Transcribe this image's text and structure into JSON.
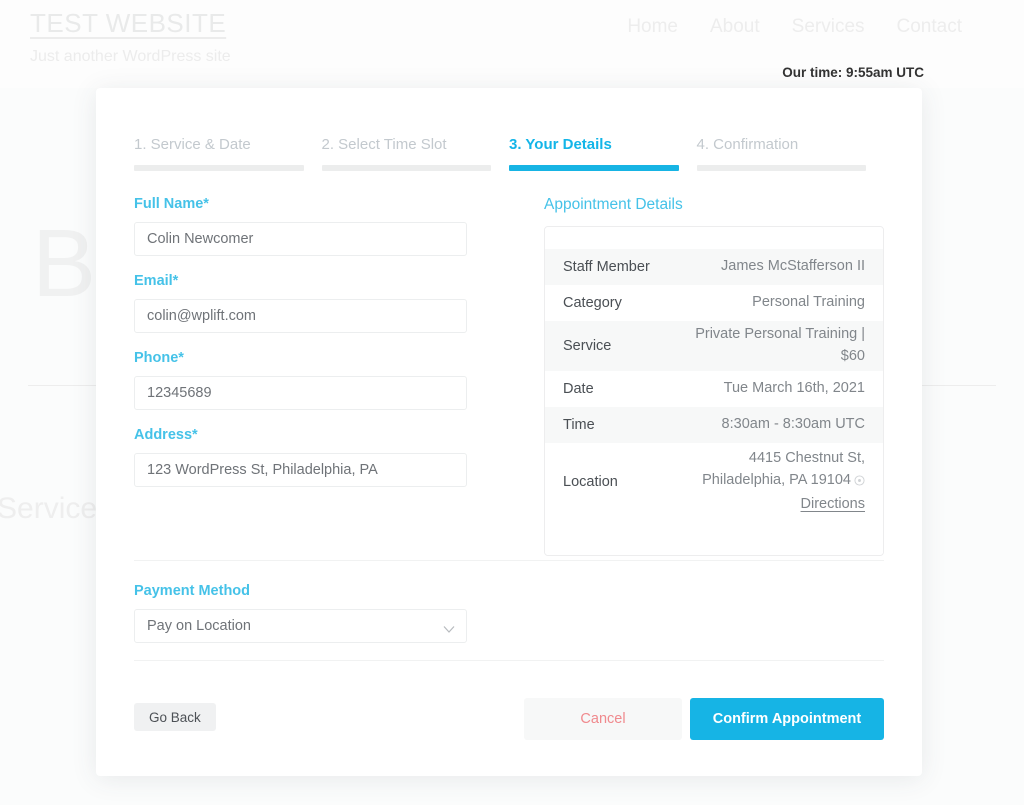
{
  "site": {
    "title": "TEST WEBSITE",
    "tagline": "Just another WordPress site",
    "nav": [
      "Home",
      "About",
      "Services",
      "Contact"
    ],
    "our_time": "Our time: 9:55am UTC",
    "hero_word": "Bo",
    "bg_subword": "ur Service"
  },
  "booking": {
    "steps": [
      {
        "label": "1. Service & Date",
        "active": false
      },
      {
        "label": "2. Select Time Slot",
        "active": false
      },
      {
        "label": "3. Your Details",
        "active": true
      },
      {
        "label": "4. Confirmation",
        "active": false
      }
    ],
    "form": {
      "fields": [
        {
          "label": "Full Name*",
          "value": "Colin Newcomer",
          "placeholder": "Full Name",
          "name": "full-name"
        },
        {
          "label": "Email*",
          "value": "colin@wplift.com",
          "placeholder": "Email",
          "name": "email"
        },
        {
          "label": "Phone*",
          "value": "12345689",
          "placeholder": "Phone",
          "name": "phone"
        },
        {
          "label": "Address*",
          "value": "123 WordPress St, Philadelphia, PA",
          "placeholder": "Address",
          "name": "address"
        }
      ]
    },
    "details": {
      "title": "Appointment Details",
      "rows": [
        {
          "key": "Staff Member",
          "value": "James McStafferson II"
        },
        {
          "key": "Category",
          "value": "Personal Training"
        },
        {
          "key": "Service",
          "value": "Private Personal Training | $60"
        },
        {
          "key": "Date",
          "value": "Tue March 16th, 2021"
        },
        {
          "key": "Time",
          "value": "8:30am - 8:30am UTC"
        }
      ],
      "location": {
        "key": "Location",
        "line1": "4415 Chestnut St,",
        "line2": "Philadelphia, PA 19104",
        "directions": "Directions",
        "pin_icon": "map-pin-icon"
      }
    },
    "payment": {
      "label": "Payment Method",
      "selected": "Pay on Location",
      "options": [
        "Pay on Location"
      ],
      "chevron_icon": "chevron-down-icon"
    },
    "buttons": {
      "go_back": "Go Back",
      "cancel": "Cancel",
      "confirm": "Confirm Appointment"
    }
  },
  "colors": {
    "accent": "#16b4e5",
    "label": "#45c2e8",
    "cancel_text": "#f08a8e",
    "step_inactive": "#c3c9ce",
    "value_text": "#81868b"
  }
}
